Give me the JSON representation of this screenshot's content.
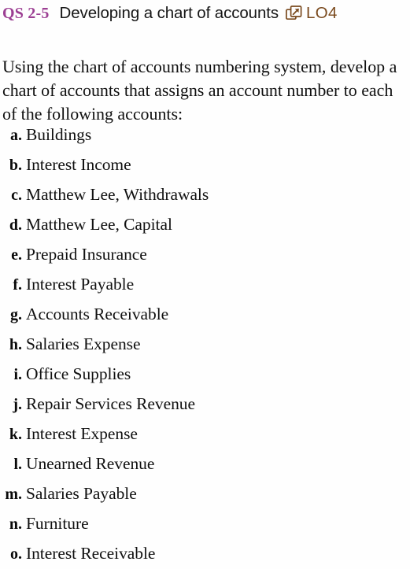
{
  "header": {
    "exercise_code": "QS 2-5",
    "title": "Developing a chart of accounts",
    "popout_icon": "external-link-icon",
    "learning_objective": "LO4",
    "accent_color_code": "#9c3f93",
    "accent_color_lo": "#7a4a1e"
  },
  "intro": {
    "text": "Using the chart of accounts numbering system, develop a chart of accounts that assigns an account number to each of the following accounts:"
  },
  "accounts": [
    {
      "marker": "a.",
      "label": "Buildings"
    },
    {
      "marker": "b.",
      "label": "Interest Income"
    },
    {
      "marker": "c.",
      "label": "Matthew Lee, Withdrawals"
    },
    {
      "marker": "d.",
      "label": "Matthew Lee, Capital"
    },
    {
      "marker": "e.",
      "label": "Prepaid Insurance"
    },
    {
      "marker": "f.",
      "label": "Interest Payable"
    },
    {
      "marker": "g.",
      "label": "Accounts Receivable"
    },
    {
      "marker": "h.",
      "label": "Salaries Expense"
    },
    {
      "marker": "i.",
      "label": "Office Supplies"
    },
    {
      "marker": "j.",
      "label": "Repair Services Revenue"
    },
    {
      "marker": "k.",
      "label": "Interest Expense"
    },
    {
      "marker": "l.",
      "label": "Unearned Revenue"
    },
    {
      "marker": "m.",
      "label": "Salaries Payable"
    },
    {
      "marker": "n.",
      "label": "Furniture"
    },
    {
      "marker": "o.",
      "label": "Interest Receivable"
    }
  ]
}
